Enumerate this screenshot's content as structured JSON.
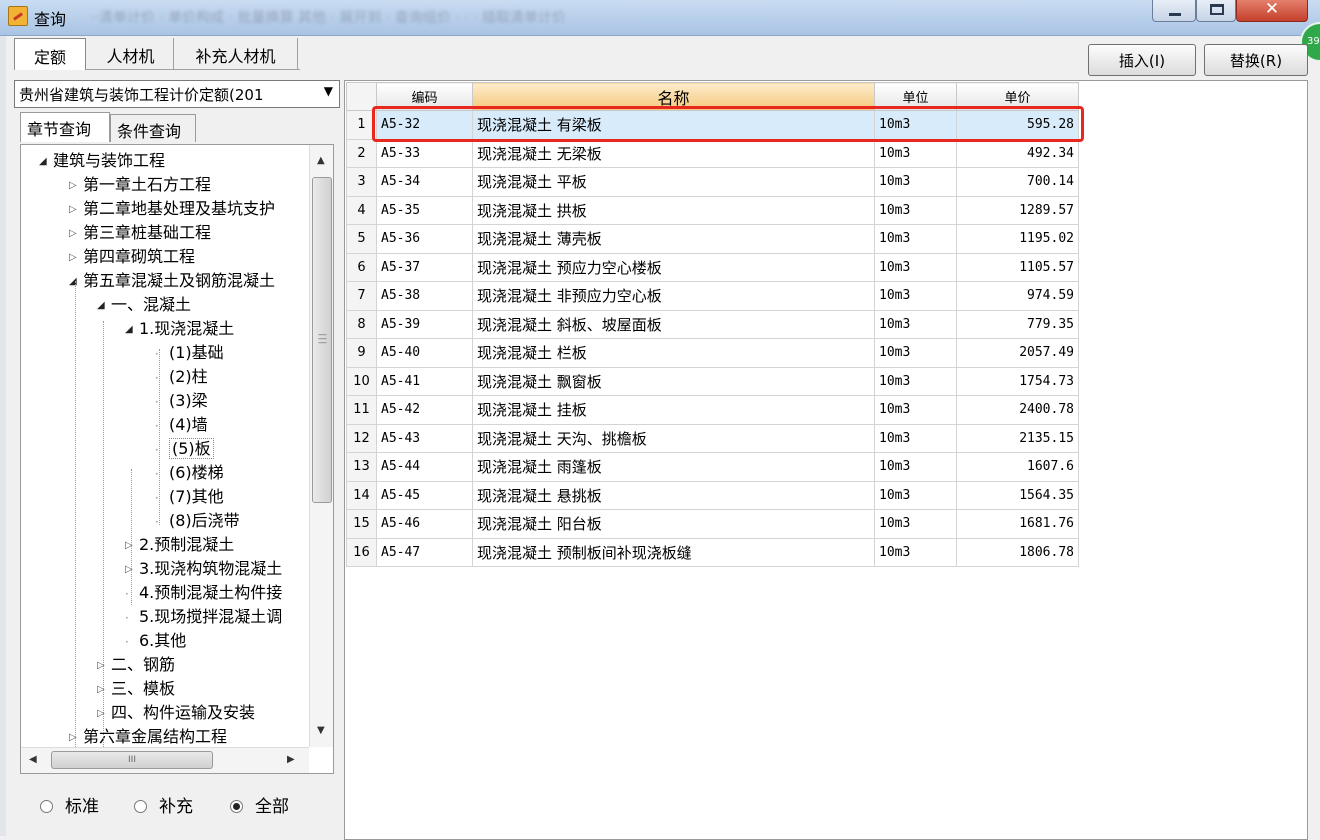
{
  "window": {
    "title": "查询",
    "blurred_toolbar": "··清单计价 · 单价构成 · 批量换算   其他 ·  展开到 · 查询组价 ·  ·  ·  插取清单计价"
  },
  "top_tabs": [
    "定额",
    "人材机",
    "补充人材机"
  ],
  "actions": {
    "insert": "插入(I)",
    "replace": "替换(R)"
  },
  "badge": "39",
  "library": "贵州省建筑与装饰工程计价定额(201",
  "sub_tabs": [
    "章节查询",
    "条件查询"
  ],
  "tree": [
    {
      "label": "建筑与装饰工程",
      "level": 0,
      "state": "open"
    },
    {
      "label": "第一章土石方工程",
      "level": 1,
      "state": "closed"
    },
    {
      "label": "第二章地基处理及基坑支护",
      "level": 1,
      "state": "closed"
    },
    {
      "label": "第三章桩基础工程",
      "level": 1,
      "state": "closed"
    },
    {
      "label": "第四章砌筑工程",
      "level": 1,
      "state": "closed"
    },
    {
      "label": "第五章混凝土及钢筋混凝土",
      "level": 1,
      "state": "open"
    },
    {
      "label": "一、混凝土",
      "level": 2,
      "state": "open"
    },
    {
      "label": "1.现浇混凝土",
      "level": 3,
      "state": "open"
    },
    {
      "label": "(1)基础",
      "level": 4,
      "state": "leaf"
    },
    {
      "label": "(2)柱",
      "level": 4,
      "state": "leaf"
    },
    {
      "label": "(3)梁",
      "level": 4,
      "state": "leaf"
    },
    {
      "label": "(4)墙",
      "level": 4,
      "state": "leaf"
    },
    {
      "label": "(5)板",
      "level": 4,
      "state": "leaf",
      "selected": true
    },
    {
      "label": "(6)楼梯",
      "level": 4,
      "state": "leaf"
    },
    {
      "label": "(7)其他",
      "level": 4,
      "state": "leaf"
    },
    {
      "label": "(8)后浇带",
      "level": 4,
      "state": "leaf"
    },
    {
      "label": "2.预制混凝土",
      "level": 3,
      "state": "closed"
    },
    {
      "label": "3.现浇构筑物混凝土",
      "level": 3,
      "state": "closed"
    },
    {
      "label": "4.预制混凝土构件接",
      "level": 3,
      "state": "leaf"
    },
    {
      "label": "5.现场搅拌混凝土调",
      "level": 3,
      "state": "leaf"
    },
    {
      "label": "6.其他",
      "level": 3,
      "state": "leaf"
    },
    {
      "label": "二、钢筋",
      "level": 2,
      "state": "closed"
    },
    {
      "label": "三、模板",
      "level": 2,
      "state": "closed"
    },
    {
      "label": "四、构件运输及安装",
      "level": 2,
      "state": "closed"
    },
    {
      "label": "第六章金属结构工程",
      "level": 1,
      "state": "closed"
    }
  ],
  "hscroll_grip": "III",
  "filters": {
    "options": [
      "标准",
      "补充",
      "全部"
    ],
    "selected": "全部"
  },
  "grid": {
    "headers": [
      "编码",
      "名称",
      "单位",
      "单价"
    ],
    "rows": [
      {
        "n": "1",
        "code": "A5-32",
        "name": "现浇混凝土 有梁板",
        "unit": "10m3",
        "price": "595.28"
      },
      {
        "n": "2",
        "code": "A5-33",
        "name": "现浇混凝土 无梁板",
        "unit": "10m3",
        "price": "492.34"
      },
      {
        "n": "3",
        "code": "A5-34",
        "name": "现浇混凝土 平板",
        "unit": "10m3",
        "price": "700.14"
      },
      {
        "n": "4",
        "code": "A5-35",
        "name": "现浇混凝土 拱板",
        "unit": "10m3",
        "price": "1289.57"
      },
      {
        "n": "5",
        "code": "A5-36",
        "name": "现浇混凝土 薄壳板",
        "unit": "10m3",
        "price": "1195.02"
      },
      {
        "n": "6",
        "code": "A5-37",
        "name": "现浇混凝土 预应力空心楼板",
        "unit": "10m3",
        "price": "1105.57"
      },
      {
        "n": "7",
        "code": "A5-38",
        "name": "现浇混凝土 非预应力空心板",
        "unit": "10m3",
        "price": "974.59"
      },
      {
        "n": "8",
        "code": "A5-39",
        "name": "现浇混凝土 斜板、坡屋面板",
        "unit": "10m3",
        "price": "779.35"
      },
      {
        "n": "9",
        "code": "A5-40",
        "name": "现浇混凝土 栏板",
        "unit": "10m3",
        "price": "2057.49"
      },
      {
        "n": "10",
        "code": "A5-41",
        "name": "现浇混凝土 飘窗板",
        "unit": "10m3",
        "price": "1754.73"
      },
      {
        "n": "11",
        "code": "A5-42",
        "name": "现浇混凝土 挂板",
        "unit": "10m3",
        "price": "2400.78"
      },
      {
        "n": "12",
        "code": "A5-43",
        "name": "现浇混凝土 天沟、挑檐板",
        "unit": "10m3",
        "price": "2135.15"
      },
      {
        "n": "13",
        "code": "A5-44",
        "name": "现浇混凝土 雨篷板",
        "unit": "10m3",
        "price": "1607.6"
      },
      {
        "n": "14",
        "code": "A5-45",
        "name": "现浇混凝土 悬挑板",
        "unit": "10m3",
        "price": "1564.35"
      },
      {
        "n": "15",
        "code": "A5-46",
        "name": "现浇混凝土 阳台板",
        "unit": "10m3",
        "price": "1681.76"
      },
      {
        "n": "16",
        "code": "A5-47",
        "name": "现浇混凝土 预制板间补现浇板缝",
        "unit": "10m3",
        "price": "1806.78"
      }
    ]
  },
  "colors": {
    "title_bar": "#b9d1ee",
    "highlight": "#e8281c",
    "selected_row": "#d8ebfa",
    "sorted_header": "#f5c77a"
  }
}
